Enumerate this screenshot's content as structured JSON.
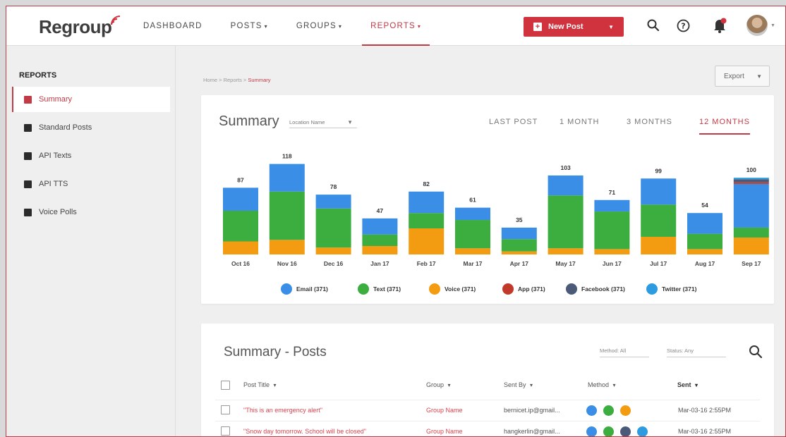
{
  "brand": {
    "name": "Regroup"
  },
  "nav": [
    {
      "label": "DASHBOARD",
      "caret": false,
      "active": false
    },
    {
      "label": "POSTS",
      "caret": true,
      "active": false
    },
    {
      "label": "GROUPS",
      "caret": true,
      "active": false
    },
    {
      "label": "REPORTS",
      "caret": true,
      "active": true
    }
  ],
  "new_post": {
    "label": "New Post"
  },
  "sidebar": {
    "title": "REPORTS",
    "items": [
      {
        "label": "Summary",
        "active": true
      },
      {
        "label": "Standard Posts",
        "active": false
      },
      {
        "label": "API Texts",
        "active": false
      },
      {
        "label": "API TTS",
        "active": false
      },
      {
        "label": "Voice Polls",
        "active": false
      }
    ]
  },
  "breadcrumb": {
    "home": "Home",
    "section": "Reports",
    "current": "Summary",
    "sep": " > "
  },
  "export_label": "Export",
  "summary": {
    "title": "Summary",
    "location_placeholder": "Location Name",
    "ranges": [
      {
        "label": "LAST POST",
        "active": false
      },
      {
        "label": "1 MONTH",
        "active": false
      },
      {
        "label": "3 MONTHS",
        "active": false
      },
      {
        "label": "12 MONTHS",
        "active": true
      }
    ]
  },
  "chart_data": {
    "type": "bar",
    "stacked": true,
    "categories": [
      "Oct 16",
      "Nov 16",
      "Dec 16",
      "Jan 17",
      "Feb 17",
      "Mar 17",
      "Apr 17",
      "May 17",
      "Jun 17",
      "Jul 17",
      "Aug 17",
      "Sep 17"
    ],
    "totals": [
      87,
      118,
      78,
      47,
      82,
      61,
      35,
      103,
      71,
      99,
      54,
      100
    ],
    "series": [
      {
        "name": "Voice (371)",
        "color": "#f39c12",
        "values": [
          17,
          19,
          9,
          11,
          34,
          8,
          4,
          8,
          7,
          23,
          7,
          22
        ]
      },
      {
        "name": "Text (371)",
        "color": "#3cae3f",
        "values": [
          40,
          63,
          51,
          15,
          20,
          37,
          16,
          69,
          49,
          42,
          20,
          13
        ]
      },
      {
        "name": "Email (371)",
        "color": "#3a8ee6",
        "values": [
          30,
          36,
          18,
          21,
          28,
          16,
          15,
          26,
          15,
          34,
          27,
          57
        ]
      },
      {
        "name": "App (371)",
        "color": "#c0392b",
        "values": [
          0,
          0,
          0,
          0,
          0,
          0,
          0,
          0,
          0,
          0,
          0,
          2
        ]
      },
      {
        "name": "Facebook (371)",
        "color": "#4a5a78",
        "values": [
          0,
          0,
          0,
          0,
          0,
          0,
          0,
          0,
          0,
          0,
          0,
          4
        ]
      },
      {
        "name": "Twitter (371)",
        "color": "#2d9be0",
        "values": [
          0,
          0,
          0,
          0,
          0,
          0,
          0,
          0,
          0,
          0,
          0,
          2
        ]
      }
    ],
    "ylim": [
      0,
      125
    ],
    "xlabel": "",
    "ylabel": "",
    "title": "",
    "grid": false,
    "legend_position": "bottom"
  },
  "legend": [
    {
      "label": "Email (371)",
      "color": "#3a8ee6"
    },
    {
      "label": "Text (371)",
      "color": "#3cae3f"
    },
    {
      "label": "Voice (371)",
      "color": "#f39c12"
    },
    {
      "label": "App (371)",
      "color": "#c0392b"
    },
    {
      "label": "Facebook (371)",
      "color": "#4a5a78"
    },
    {
      "label": "Twitter (371)",
      "color": "#2d9be0"
    }
  ],
  "posts": {
    "title": "Summary - Posts",
    "filter_method": "Method: All",
    "filter_status": "Status: Any",
    "headers": {
      "title": "Post Title",
      "group": "Group",
      "sent_by": "Sent By",
      "method": "Method",
      "sent": "Sent"
    },
    "rows": [
      {
        "title": "\"This is an emergency alert\"",
        "group": "Group Name",
        "sent_by": "bernicet.ip@gmail...",
        "methods": [
          "email",
          "text",
          "voice"
        ],
        "sent": "Mar-03-16 2:55PM"
      },
      {
        "title": "\"Snow day tomorrow. School will be closed\"",
        "group": "Group Name",
        "sent_by": "hangkerlin@gmail...",
        "methods": [
          "email",
          "text",
          "facebook",
          "twitter"
        ],
        "sent": "Mar-03-16 2:55PM"
      }
    ]
  },
  "method_colors": {
    "email": "#3a8ee6",
    "text": "#3cae3f",
    "voice": "#f39c12",
    "app": "#c0392b",
    "facebook": "#4a5a78",
    "twitter": "#2d9be0"
  },
  "icons": [
    "search-icon",
    "help-icon",
    "bell-icon",
    "avatar",
    "new-post-icon"
  ]
}
